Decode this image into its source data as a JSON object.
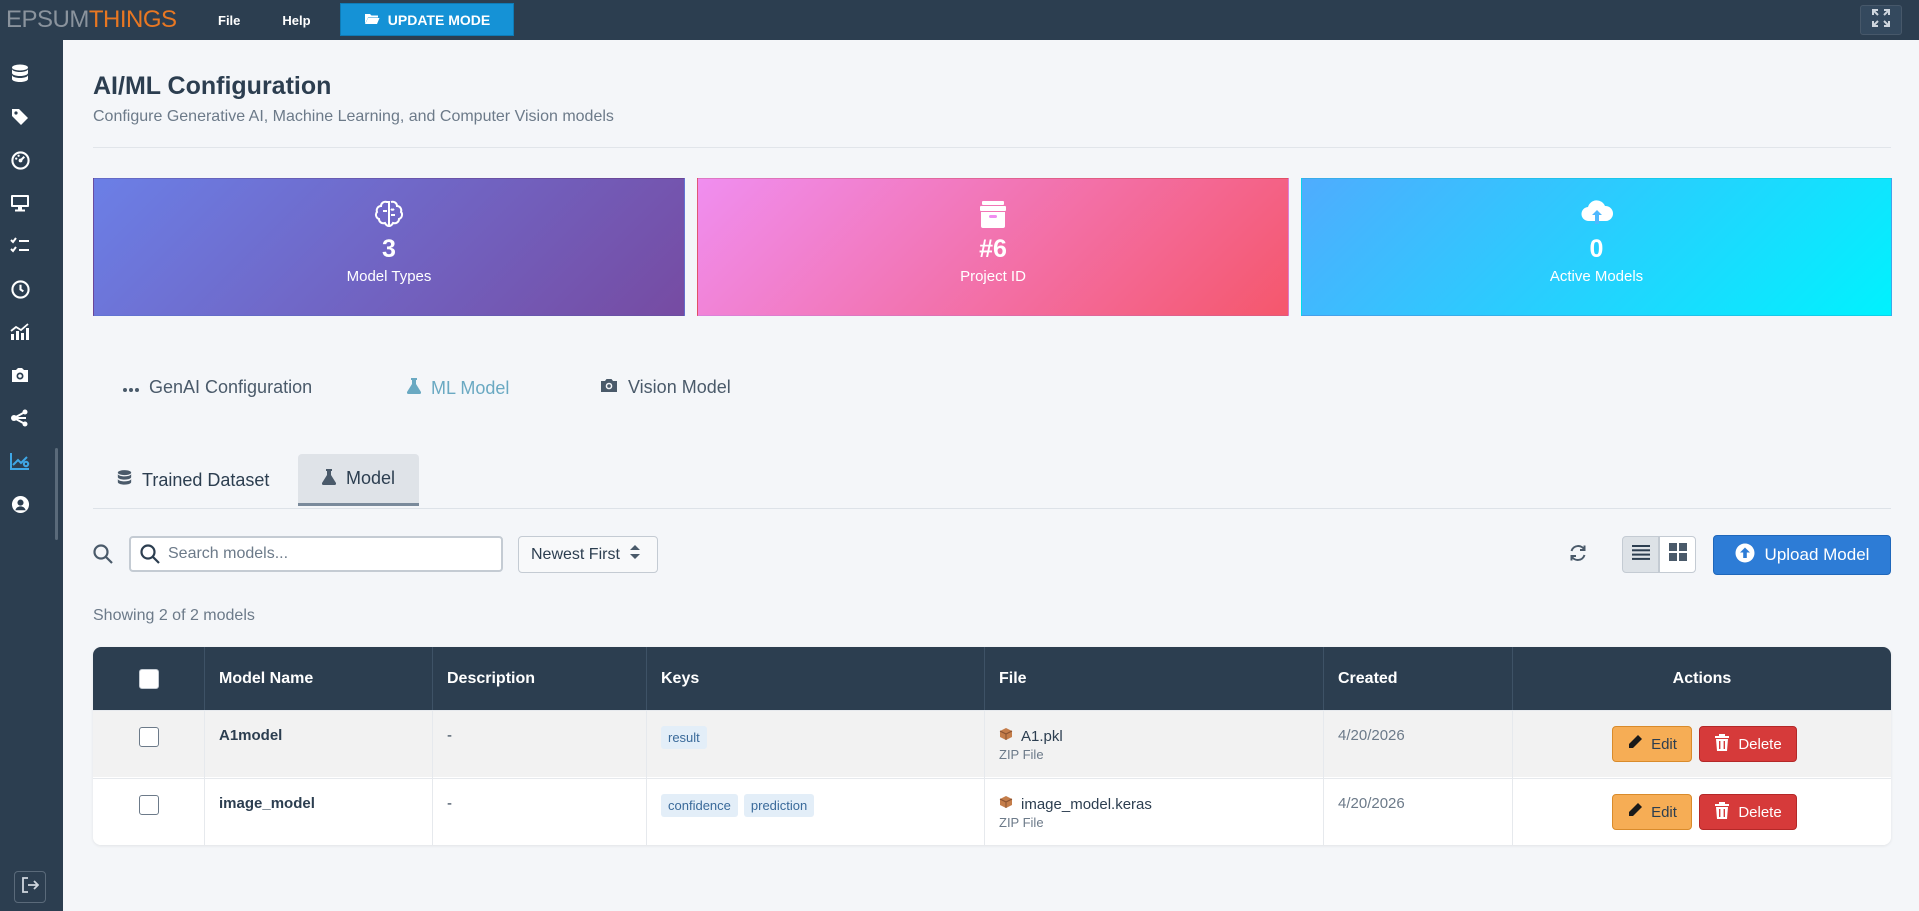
{
  "topbar": {
    "logo_part1": "EPSUM",
    "logo_part2": "THINGS",
    "menu": [
      "File",
      "Help"
    ],
    "update_mode_label": "UPDATE MODE"
  },
  "sidebar": {
    "icons": [
      "database-icon",
      "tag-icon",
      "dashboard-icon",
      "monitor-icon",
      "tasks-icon",
      "clock-icon",
      "chart-icon",
      "camera-icon",
      "network-icon",
      "analytics-icon",
      "user-icon"
    ],
    "active_index": 9
  },
  "page": {
    "title": "AI/ML Configuration",
    "subtitle": "Configure Generative AI, Machine Learning, and Computer Vision models"
  },
  "stats": [
    {
      "value": "3",
      "label": "Model Types",
      "icon": "brain-icon"
    },
    {
      "value": "#6",
      "label": "Project ID",
      "icon": "archive-icon"
    },
    {
      "value": "0",
      "label": "Active Models",
      "icon": "cloud-upload-icon"
    }
  ],
  "main_tabs": [
    {
      "label": "GenAI Configuration",
      "icon": "dots-icon"
    },
    {
      "label": "ML Model",
      "icon": "flask-icon",
      "active": true
    },
    {
      "label": "Vision Model",
      "icon": "camera-icon"
    }
  ],
  "sub_tabs": [
    {
      "label": "Trained Dataset",
      "icon": "database-icon"
    },
    {
      "label": "Model",
      "icon": "flask-icon",
      "active": true
    }
  ],
  "toolbar": {
    "search_placeholder": "Search models...",
    "sort_value": "Newest First",
    "upload_label": "Upload Model"
  },
  "showing_text": "Showing 2 of 2 models",
  "table": {
    "columns": [
      "Model Name",
      "Description",
      "Keys",
      "File",
      "Created",
      "Actions"
    ],
    "rows": [
      {
        "name": "A1model",
        "description": "-",
        "keys": [
          "result"
        ],
        "file": "A1.pkl",
        "file_type": "ZIP File",
        "created": "4/20/2026"
      },
      {
        "name": "image_model",
        "description": "-",
        "keys": [
          "confidence",
          "prediction"
        ],
        "file": "image_model.keras",
        "file_type": "ZIP File",
        "created": "4/20/2026"
      }
    ],
    "edit_label": "Edit",
    "delete_label": "Delete"
  }
}
